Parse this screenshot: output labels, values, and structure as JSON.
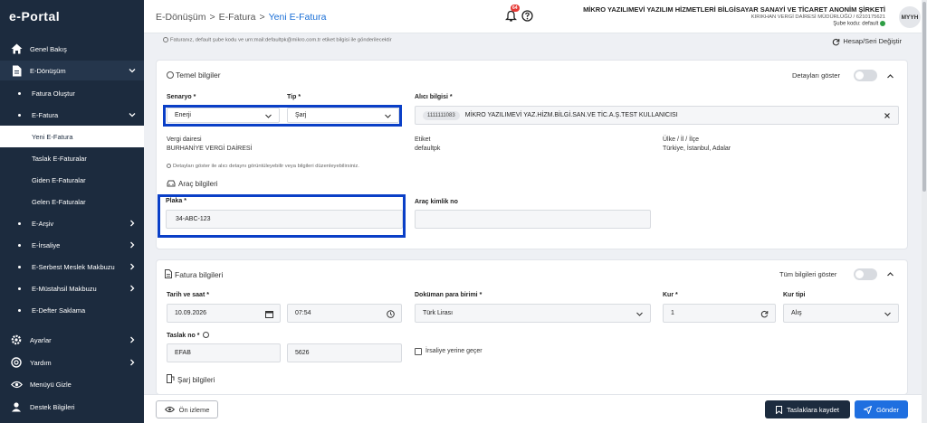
{
  "app": {
    "logo": "e-Portal"
  },
  "sidebar": {
    "items": [
      {
        "label": "Genel Bakış",
        "icon": "home-icon"
      },
      {
        "label": "E-Dönüşüm",
        "icon": "document-icon"
      },
      {
        "label": "Fatura Oluştur"
      },
      {
        "label": "E-Fatura"
      },
      {
        "label": "Yeni E-Fatura"
      },
      {
        "label": "Taslak E-Faturalar"
      },
      {
        "label": "Giden E-Faturalar"
      },
      {
        "label": "Gelen E-Faturalar"
      },
      {
        "label": "E-Arşiv"
      },
      {
        "label": "E-İrsaliye"
      },
      {
        "label": "E-Serbest Meslek Makbuzu"
      },
      {
        "label": "E-Müstahsil Makbuzu"
      },
      {
        "label": "E-Defter Saklama"
      },
      {
        "label": "Ayarlar",
        "icon": "gear-icon"
      },
      {
        "label": "Yardım",
        "icon": "help-icon"
      },
      {
        "label": "Menüyü Gizle",
        "icon": "eye-icon"
      },
      {
        "label": "Destek Bilgileri",
        "icon": "user-icon"
      }
    ]
  },
  "header": {
    "breadcrumb": [
      "E-Dönüşüm",
      ">",
      "E-Fatura",
      ">",
      "Yeni E-Fatura"
    ],
    "notification_count": "64",
    "company_name": "MİKRO YAZILIMEVİ YAZILIM HİZMETLERİ BİLGİSAYAR SANAYİ VE TİCARET ANONİM ŞİRKETİ",
    "tax_office": "KIRIKHAN VERGİ DAİRESİ MÜDÜRLÜĞÜ / 6210175621",
    "branch": "Şube kodu: default",
    "avatar": "MYYH"
  },
  "info_line": "Faturanız, default şube kodu ve urn:mail:defaultpk@mikro.com.tr etiket bilgisi ile gönderilecektir",
  "hesap_seri": "Hesap/Seri Değiştir",
  "temel": {
    "title": "Temel bilgiler",
    "details_toggle": "Detayları göster",
    "senaryo_label": "Senaryo *",
    "senaryo_value": "Enerji",
    "tip_label": "Tip *",
    "tip_value": "Şarj",
    "alici_label": "Alıcı bilgisi *",
    "alici_code": "1111111083",
    "alici_name": "MİKRO YAZILIMEVİ YAZ.HİZM.BİLGİ.SAN.VE TİC.A.Ş.TEST KULLANICISI",
    "vergi_label": "Vergi dairesi",
    "vergi_value": "BURHANİYE VERGİ DAİRESİ",
    "etiket_label": "Etiket",
    "etiket_value": "defaultpk",
    "ulke_label": "Ülke / İl / İlçe",
    "ulke_value": "Türkiye, İstanbul, Adalar",
    "hint": "Detayları göster ile alıcı detaynı görüntüleyebilir veya bilgileri düzenleyebilirsiniz.",
    "arac_title": "Araç bilgileri",
    "plaka_label": "Plaka *",
    "plaka_value": "34-ABC-123",
    "arac_kimlik_label": "Araç kimlik no",
    "arac_kimlik_value": ""
  },
  "fatura": {
    "title": "Fatura bilgileri",
    "all_toggle": "Tüm bilgileri göster",
    "tarih_label": "Tarih ve saat *",
    "tarih_value": "10.09.2026",
    "saat_value": "07:54",
    "para_label": "Doküman para birimi *",
    "para_value": "Türk Lirası",
    "kur_label": "Kur *",
    "kur_value": "1",
    "kur_tipi_label": "Kur tipi",
    "kur_tipi_value": "Alış",
    "taslak_label": "Taslak no *",
    "taslak_prefix": "EFAB",
    "taslak_number": "5626",
    "irsaliye_label": "İrsaliye yerine geçer",
    "sarj_title": "Şarj bilgileri"
  },
  "footer": {
    "preview": "Ön izleme",
    "save_draft": "Taslaklara kaydet",
    "send": "Gönder"
  },
  "colors": {
    "sidebar": "#1c2b3e",
    "accent": "#1a6fd6",
    "highlight": "#0a3fc7",
    "badge": "#e53935",
    "send": "#1f6fe0"
  }
}
